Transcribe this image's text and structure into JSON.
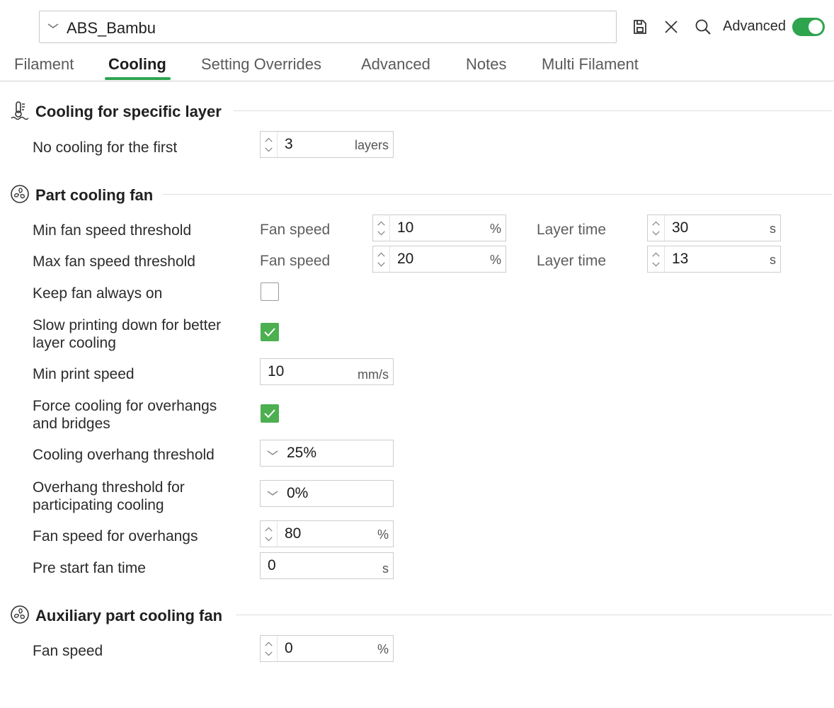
{
  "header": {
    "preset": "ABS_Bambu",
    "advanced_label": "Advanced",
    "advanced_on": true,
    "icons": [
      "chevron-down-icon",
      "save-icon",
      "close-icon",
      "search-icon"
    ]
  },
  "tabs": [
    "Filament",
    "Cooling",
    "Setting Overrides",
    "Advanced",
    "Notes",
    "Multi Filament"
  ],
  "active_tab": "Cooling",
  "colors": {
    "accent": "#2ea44f",
    "checkbox_on": "#4caf50"
  },
  "sections": {
    "specific_layer": {
      "title": "Cooling for specific layer",
      "no_cooling_label": "No cooling for the first",
      "no_cooling_value": "3",
      "no_cooling_unit": "layers"
    },
    "part_fan": {
      "title": "Part cooling fan",
      "min_fan": {
        "label": "Min fan speed threshold",
        "fan_label": "Fan speed",
        "fan_value": "10",
        "fan_unit": "%",
        "time_label": "Layer time",
        "time_value": "30",
        "time_unit": "s"
      },
      "max_fan": {
        "label": "Max fan speed threshold",
        "fan_label": "Fan speed",
        "fan_value": "20",
        "fan_unit": "%",
        "time_label": "Layer time",
        "time_value": "13",
        "time_unit": "s"
      },
      "keep_fan_on": {
        "label": "Keep fan always on",
        "checked": false
      },
      "slow_down": {
        "label_line1": "Slow printing down for better",
        "label_line2": "layer cooling",
        "checked": true
      },
      "min_print_speed": {
        "label": "Min print speed",
        "value": "10",
        "unit": "mm/s"
      },
      "force_cooling": {
        "label_line1": "Force cooling for overhangs",
        "label_line2": "and bridges",
        "checked": true
      },
      "overhang_threshold": {
        "label": "Cooling overhang threshold",
        "value": "25%"
      },
      "overhang_participating": {
        "label_line1": "Overhang threshold for",
        "label_line2": "participating cooling",
        "value": "0%"
      },
      "overhang_fan_speed": {
        "label": "Fan speed for overhangs",
        "value": "80",
        "unit": "%"
      },
      "pre_start_fan": {
        "label": "Pre start fan time",
        "value": "0",
        "unit": "s"
      }
    },
    "aux_fan": {
      "title": "Auxiliary part cooling fan",
      "fan_speed_label": "Fan speed",
      "fan_speed_value": "0",
      "fan_speed_unit": "%"
    }
  }
}
